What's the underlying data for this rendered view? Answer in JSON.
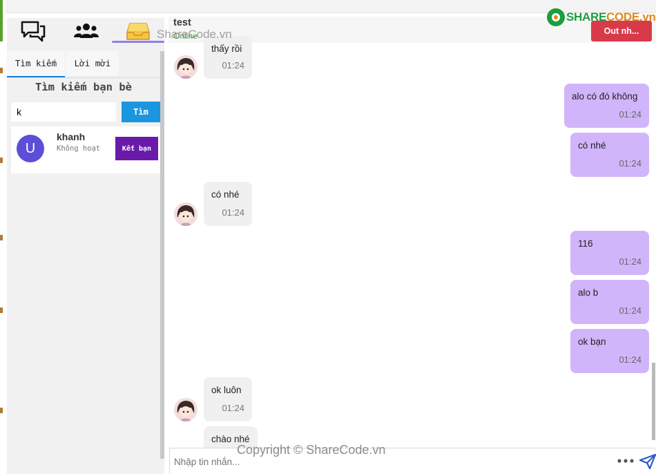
{
  "branding": {
    "logo_part1": "SHARE",
    "logo_part2": "CODE.vn",
    "watermark_top": "ShareCode.vn",
    "watermark_bottom": "Copyright © ShareCode.vn"
  },
  "nav": {
    "icons": [
      "chat-bubbles-icon",
      "users-icon",
      "inbox-tray-icon"
    ],
    "active_index": 2,
    "accent": "#8f7fe6"
  },
  "sidebar": {
    "tabs": [
      {
        "label": "Tìm kiếm",
        "active": true
      },
      {
        "label": "Lời mời",
        "active": false
      }
    ],
    "search_title": "Tìm kiếm bạn bè",
    "search_value": "k",
    "search_button": "Tìm",
    "results": [
      {
        "avatar_letter": "U",
        "name": "khanh",
        "status": "Không hoạt động",
        "action": "Kết bạn"
      }
    ]
  },
  "chat": {
    "name": "test",
    "status": "Online",
    "out_button": "Out nh...",
    "input_placeholder": "Nhập tin nhắn...",
    "messages": [
      {
        "dir": "in",
        "text": "thấy rồi",
        "time": "01:24"
      },
      {
        "dir": "out",
        "text": "alo có đó không",
        "time": "01:24"
      },
      {
        "dir": "out",
        "text": "có nhé",
        "time": "01:24"
      },
      {
        "dir": "in",
        "text": "có nhé",
        "time": "01:24"
      },
      {
        "dir": "out",
        "text": "116",
        "time": "01:24"
      },
      {
        "dir": "out",
        "text": "alo b",
        "time": "01:24"
      },
      {
        "dir": "out",
        "text": "ok bạn",
        "time": "01:24"
      },
      {
        "dir": "in",
        "text": "ok luôn",
        "time": "01:24"
      },
      {
        "dir": "in",
        "text": "chào nhé",
        "time": ""
      }
    ]
  },
  "colors": {
    "outgoing_bubble": "#d1b5fb",
    "incoming_bubble": "#f0f0f0",
    "search_button": "#1a96df",
    "add_friend_button": "#6a1aa9",
    "out_button": "#d93a4a",
    "online": "#40a040"
  }
}
